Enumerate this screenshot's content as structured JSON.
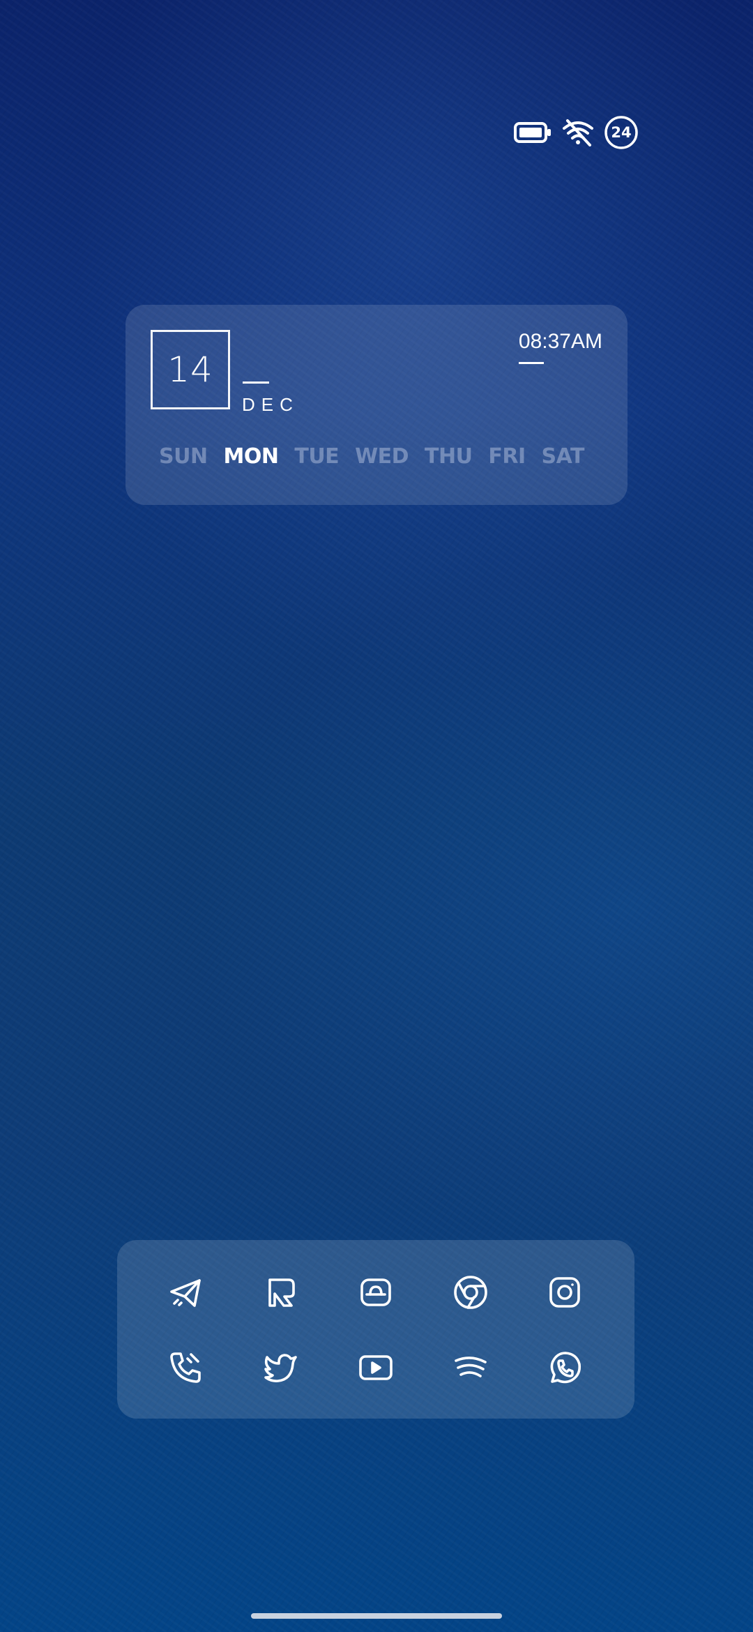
{
  "status_bar": {
    "battery_icon": "battery-icon",
    "wifi_icon": "wifi-off-icon",
    "badge_text": "24"
  },
  "calendar_widget": {
    "day": "14",
    "month": "DEC",
    "time": "08:37AM",
    "weekdays": [
      "SUN",
      "MON",
      "TUE",
      "WED",
      "THU",
      "FRI",
      "SAT"
    ],
    "active_weekday": "MON"
  },
  "dock": {
    "apps": [
      {
        "icon": "telegram-icon"
      },
      {
        "icon": "reeder-icon"
      },
      {
        "icon": "store-icon"
      },
      {
        "icon": "chrome-icon"
      },
      {
        "icon": "instagram-icon"
      },
      {
        "icon": "phone-icon"
      },
      {
        "icon": "twitter-icon"
      },
      {
        "icon": "youtube-icon"
      },
      {
        "icon": "spotify-icon"
      },
      {
        "icon": "whatsapp-icon"
      }
    ]
  },
  "colors": {
    "background_top": "#0b236a",
    "background_bottom": "#034487",
    "foreground": "#ffffff"
  }
}
